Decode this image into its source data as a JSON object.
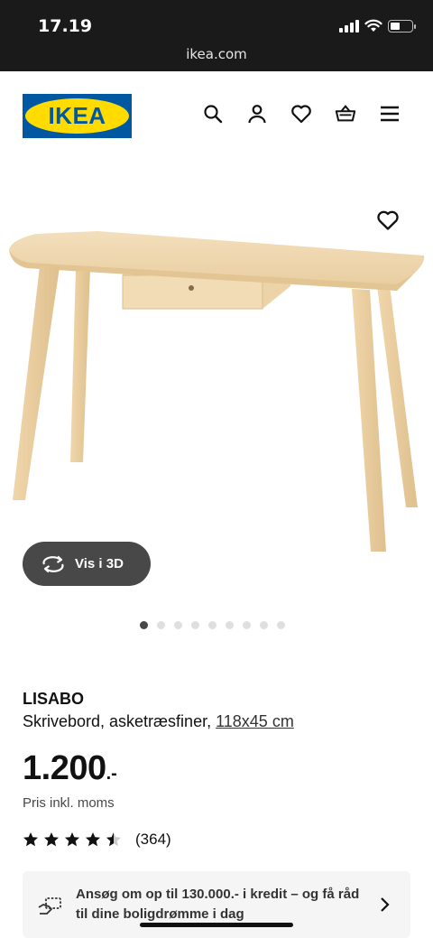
{
  "status_bar": {
    "time": "17.19",
    "url": "ikea.com"
  },
  "header": {
    "logo_text": "IKEA",
    "icons": [
      "search-icon",
      "account-icon",
      "heart-icon",
      "basket-icon",
      "menu-icon"
    ]
  },
  "gallery": {
    "vis3d_label": "Vis i 3D",
    "dot_count": 9,
    "active_dot": 0
  },
  "product": {
    "name": "LISABO",
    "description": "Skrivebord, asketræsfiner, ",
    "size": "118x45 cm",
    "price": "1.200",
    "price_suffix": ".-",
    "price_note": "Pris inkl. moms",
    "rating_value": 4.5,
    "rating_count": "(364)"
  },
  "credit": {
    "text": "Ansøg om op til 130.000.- i kredit – og få råd til dine boligdrømme i dag"
  },
  "colors": {
    "ikea_blue": "#0058a3",
    "ikea_yellow": "#ffdb00",
    "wood": "#f1d9b0"
  }
}
